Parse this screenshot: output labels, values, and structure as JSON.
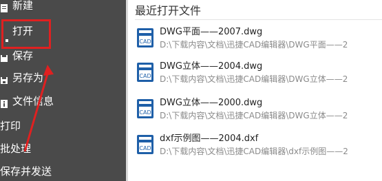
{
  "sidebar": {
    "items": [
      {
        "label": "新建",
        "icon": "new-file-icon"
      },
      {
        "label": "打开",
        "icon": "open-folder-icon"
      },
      {
        "label": "保存",
        "icon": "save-icon"
      },
      {
        "label": "另存为",
        "icon": "save-as-icon"
      },
      {
        "label": "文件信息",
        "icon": "file-info-icon"
      },
      {
        "label": "打印"
      },
      {
        "label": "批处理"
      },
      {
        "label": "保存并发送"
      }
    ]
  },
  "recent": {
    "title": "最近打开文件",
    "icon_text": "CAD",
    "files": [
      {
        "name": "DWG平面——2007.dwg",
        "path": "D:\\下载内容\\文档\\迅捷CAD编辑器\\DWG平面——2"
      },
      {
        "name": "DWG立体——2004.dwg",
        "path": "D:\\下载内容\\文档\\迅捷CAD编辑器\\DWG立体——2"
      },
      {
        "name": "DWG立体——2000.dwg",
        "path": "D:\\下载内容\\文档\\迅捷CAD编辑器\\DWG立体——2"
      },
      {
        "name": "dxf示例图——2004.dxf",
        "path": "D:\\下载内容\\文档\\迅捷CAD编辑器\\dxf示例图——2"
      }
    ]
  },
  "colors": {
    "sidebar_bg": "#4a4a4a",
    "annotation_red": "#e02020",
    "cad_icon_blue": "#1e5fa8"
  }
}
